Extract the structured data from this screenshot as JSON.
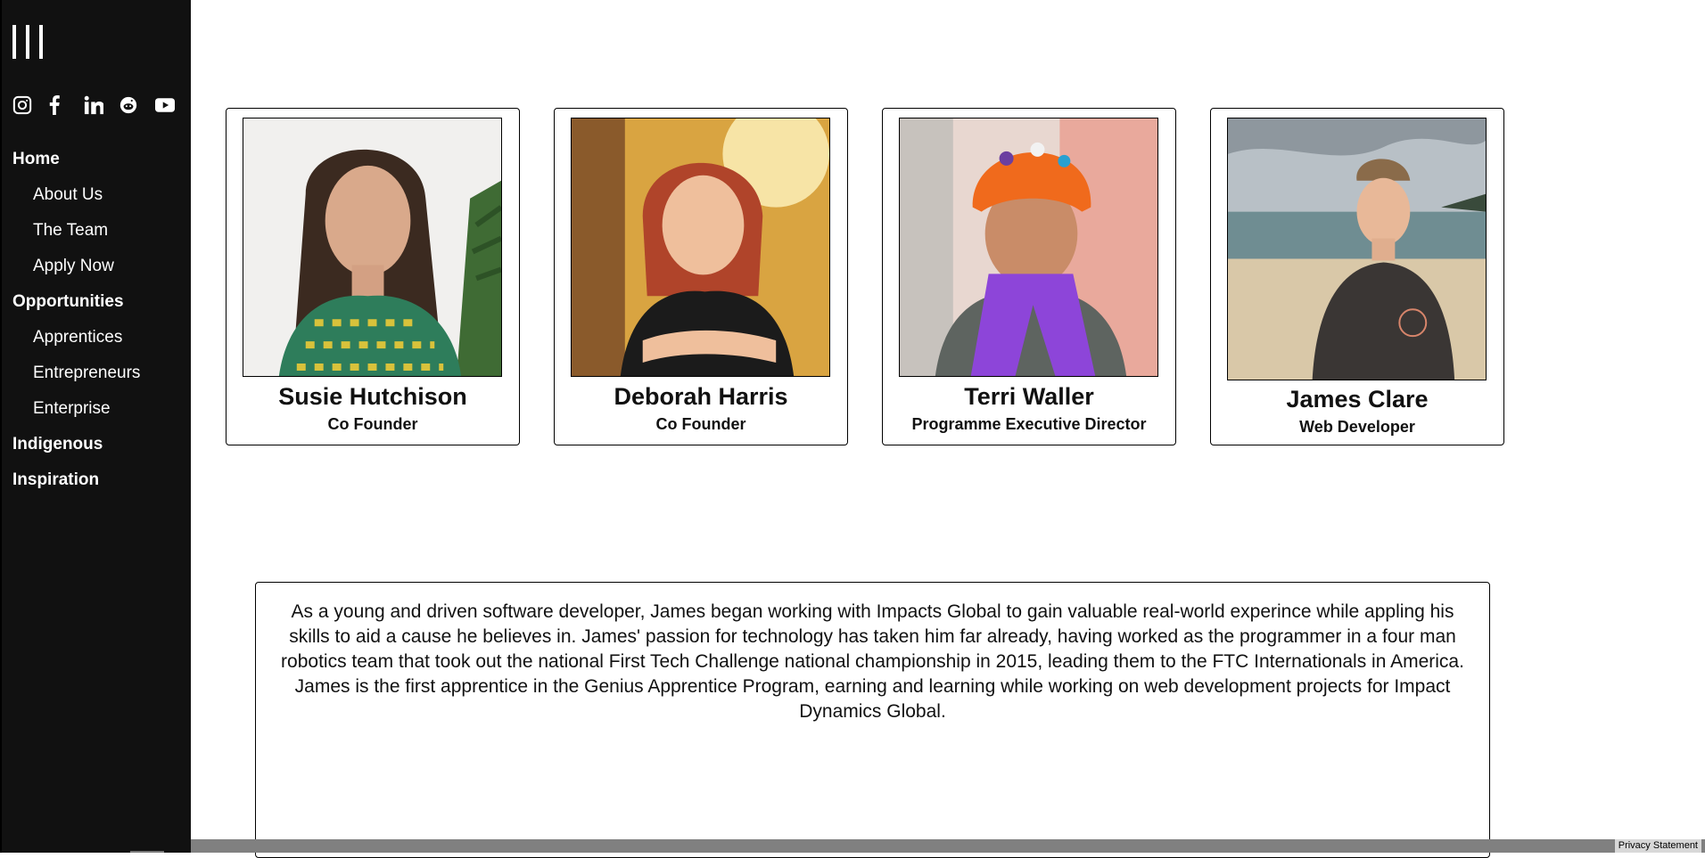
{
  "sidebar": {
    "menu_icon": "hamburger-vertical-icon",
    "social": [
      {
        "name": "instagram",
        "icon": "instagram-icon"
      },
      {
        "name": "facebook",
        "icon": "facebook-icon"
      },
      {
        "name": "linkedin",
        "icon": "linkedin-icon"
      },
      {
        "name": "reddit",
        "icon": "reddit-icon"
      },
      {
        "name": "youtube",
        "icon": "youtube-icon"
      }
    ],
    "nav": {
      "home": "Home",
      "about": "About Us",
      "team": "The Team",
      "apply": "Apply Now",
      "opportunities": "Opportunities",
      "apprentices": "Apprentices",
      "entrepreneurs": "Entrepreneurs",
      "enterprise": "Enterprise",
      "indigenous": "Indigenous",
      "inspiration": "Inspiration"
    }
  },
  "team": [
    {
      "name": "Susie Hutchison",
      "role": "Co Founder"
    },
    {
      "name": "Deborah Harris",
      "role": "Co Founder"
    },
    {
      "name": "Terri Waller",
      "role": "Programme Executive Director"
    },
    {
      "name": "James Clare",
      "role": "Web Developer"
    }
  ],
  "bio": {
    "text": "As a young and driven software developer, James began working with Impacts Global to gain valuable real-world experince while appling his skills to aid a cause he believes in. James' passion for technology has taken him far already, having worked as the programmer in a four man robotics team that took out the national First Tech Challenge national championship in 2015, leading them to the FTC Internationals in America. James is the first apprentice in the Genius Apprentice Program, earning and learning while working on web development projects for Impact Dynamics Global."
  },
  "footer": {
    "privacy": "Privacy Statement"
  },
  "colors": {
    "sidebar_bg": "#111111",
    "accent_text": "#ffffff",
    "bottom_bar": "#808080"
  }
}
